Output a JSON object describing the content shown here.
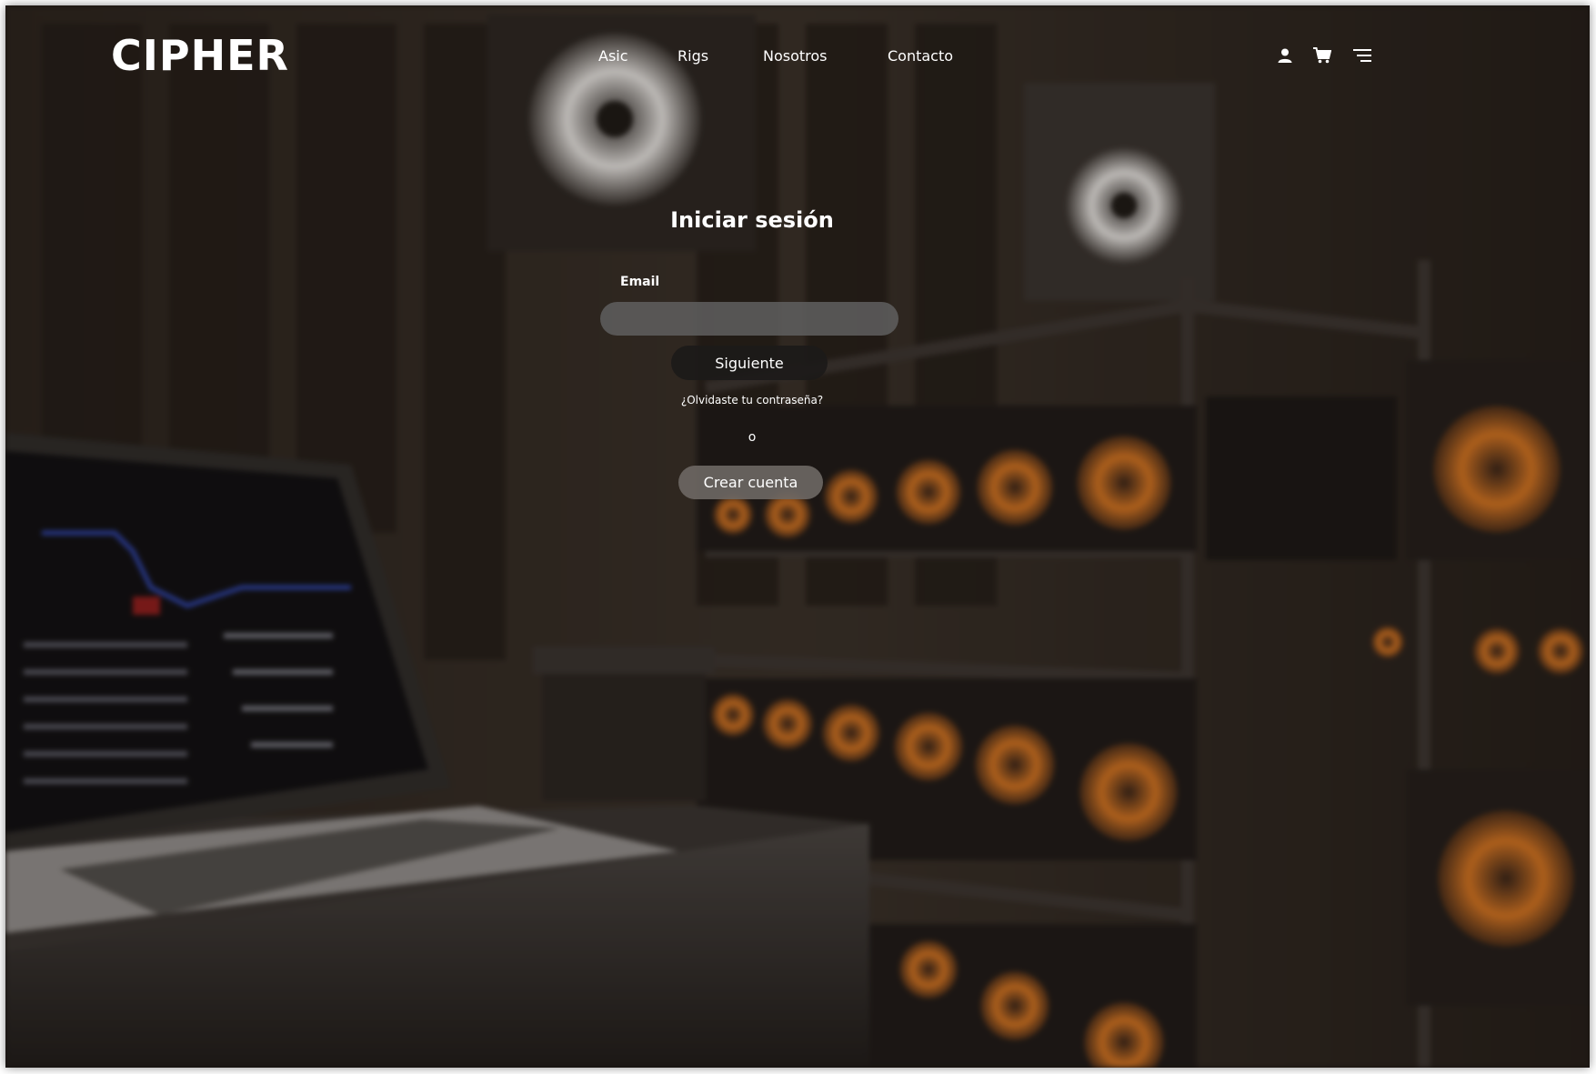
{
  "brand": {
    "name": "CIPHER"
  },
  "nav": {
    "links": [
      "Asic",
      "Rigs",
      "Nosotros",
      "Contacto"
    ],
    "icons": [
      "user-icon",
      "cart-icon",
      "menu-icon"
    ]
  },
  "login": {
    "title": "Iniciar sesión",
    "email_label": "Email",
    "email_value": "",
    "next_button": "Siguiente",
    "forgot_link": "¿Olvidaste tu contraseña?",
    "or_text": "o",
    "create_button": "Crear cuenta"
  },
  "colors": {
    "text": "#ffffff",
    "background": "#1a1512",
    "fan_accent": "#e07a22",
    "input_bg": "#5f5f5f",
    "next_button_bg": "#1c1a19",
    "create_button_bg": "#6e6864"
  }
}
